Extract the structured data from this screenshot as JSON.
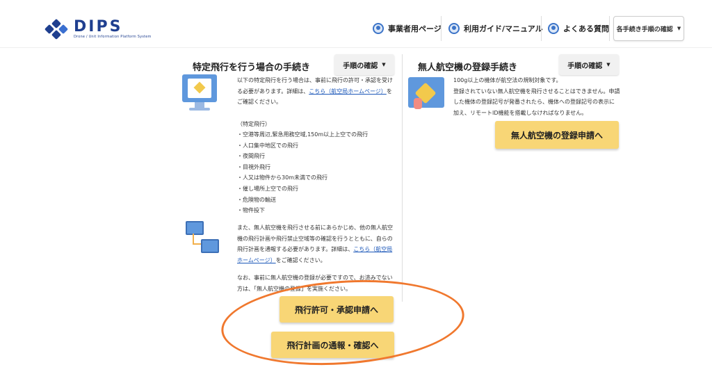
{
  "header": {
    "logo_title": "DIPS",
    "logo_subtitle": "Drone / Unit Information Platform System",
    "nav": [
      {
        "label": "事業者用ページ",
        "icon": "drone-icon"
      },
      {
        "label": "利用ガイド/マニュアル",
        "icon": "drone-icon"
      },
      {
        "label": "よくある質問",
        "icon": "drone-icon"
      }
    ],
    "procedures_button": "各手続き手順の確認"
  },
  "left": {
    "title": "特定飛行を行う場合の手続き",
    "dropdown": "手順の確認",
    "intro_1": "以下の特定飛行を行う場合は、事前に飛行の許可・承認を受け",
    "intro_2": "る必要があります。詳細は、",
    "intro_link": "こちら（航空局ホームページ）",
    "intro_3": "を",
    "intro_4": "ご確認ください。",
    "list_heading": "（特定飛行）",
    "list": [
      "・空港等周辺,緊急用務空域,150m以上上空での飛行",
      "・人口集中地区での飛行",
      "・夜間飛行",
      "・目視外飛行",
      "・人又は物件から30m未満での飛行",
      "・催し場所上空での飛行",
      "・危険物の輸送",
      "・物件投下"
    ],
    "para2_1": "また、無人航空機を飛行させる前にあらかじめ、他の無人航空",
    "para2_2": "機の飛行計画や飛行禁止空域等の確認を行うとともに、自らの",
    "para2_3": "飛行計画を通報する必要があります。詳細は、",
    "para2_link_a": "こちら（航空局",
    "para2_link_b": "ホームページ）",
    "para2_4": "をご確認ください。",
    "note_1": "なお、事前に無人航空機の登録が必要ですので、お済みでない",
    "note_2": "方は、「無人航空機の登録」を実施ください。",
    "btn_permit": "飛行許可・承認申請へ",
    "btn_plan": "飛行計画の通報・確認へ"
  },
  "right": {
    "title": "無人航空機の登録手続き",
    "dropdown": "手順の確認",
    "text_1": "100g以上の機体が航空法の規制対象です。",
    "text_2": "登録されていない無人航空機を飛行させることはできません。申請",
    "text_3": "した機体の登録記号が発番されたら、機体への登録記号の表示に",
    "text_4": "加え、リモートID機能を搭載しなければなりません。",
    "btn_register": "無人航空機の登録申請へ"
  },
  "colors": {
    "cta": "#f8d676",
    "brand": "#1f3f8f",
    "link": "#1a56b8",
    "annotation": "#f0782e"
  }
}
